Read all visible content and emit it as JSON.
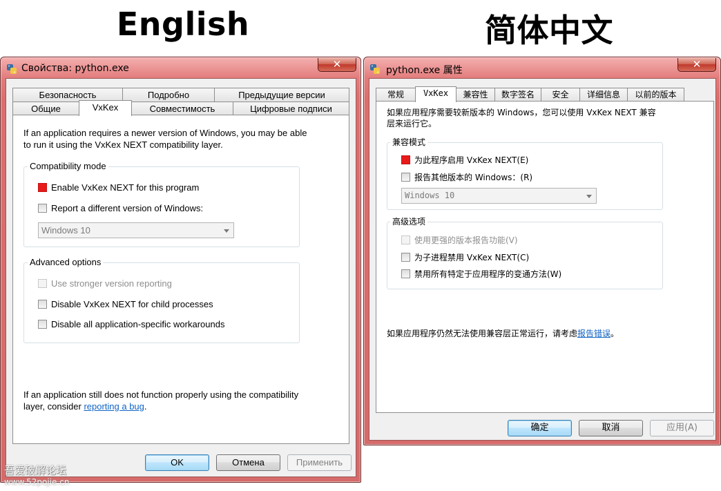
{
  "headings": {
    "english": "English",
    "chinese": "简体中文"
  },
  "colors": {
    "accent_red": "#e81a1a",
    "link_blue": "#0f63c5",
    "title_gradient": "#dc6e6e"
  },
  "icons": {
    "window_icon": "python-icon",
    "close": "close-icon",
    "dropdown": "chevron-down-icon"
  },
  "en": {
    "title": "Свойства: python.exe",
    "close_label": "✕",
    "tabs_row1": [
      "Безопасность",
      "Подробно",
      "Предыдущие версии"
    ],
    "tabs_row2": [
      "Общие",
      "VxKex",
      "Совместимость",
      "Цифровые подписи"
    ],
    "intro": "If an application requires a newer version of Windows, you may be able to run it using the VxKex NEXT compatibility layer.",
    "compat_group": "Compatibility mode",
    "enable_label": "Enable VxKex NEXT for this program",
    "report_label": "Report a different version of Windows:",
    "version_value": "Windows 10",
    "advanced_group": "Advanced options",
    "stronger_label": "Use stronger version reporting",
    "child_label": "Disable VxKex NEXT for child processes",
    "workarounds_label": "Disable all application-specific workarounds",
    "footer_text": "If an application still does not function properly using the compatibility layer, consider ",
    "footer_link": "reporting a bug",
    "footer_end": ".",
    "ok": "OK",
    "cancel": "Отмена",
    "apply": "Применить"
  },
  "zh": {
    "title": "python.exe 属性",
    "close_label": "✕",
    "tabs": [
      "常规",
      "VxKex",
      "兼容性",
      "数字签名",
      "安全",
      "详细信息",
      "以前的版本"
    ],
    "intro": "如果应用程序需要较新版本的 Windows，您可以使用 VxKex NEXT 兼容层来运行它。",
    "compat_group": "兼容模式",
    "enable_label": "为此程序启用 VxKex NEXT(E)",
    "report_label": "报告其他版本的 Windows：(R)",
    "version_value": "Windows 10",
    "advanced_group": "高级选项",
    "stronger_label": "使用更强的版本报告功能(V)",
    "child_label": "为子进程禁用 VxKex NEXT(C)",
    "workarounds_label": "禁用所有特定于应用程序的变通方法(W)",
    "footer_text": "如果应用程序仍然无法使用兼容层正常运行，请考虑",
    "footer_link": "报告错误",
    "footer_end": "。",
    "ok": "确定",
    "cancel": "取消",
    "apply": "应用(A)"
  },
  "watermark": {
    "name": "吾爱破解论坛",
    "url": "www.52pojie.cn"
  }
}
